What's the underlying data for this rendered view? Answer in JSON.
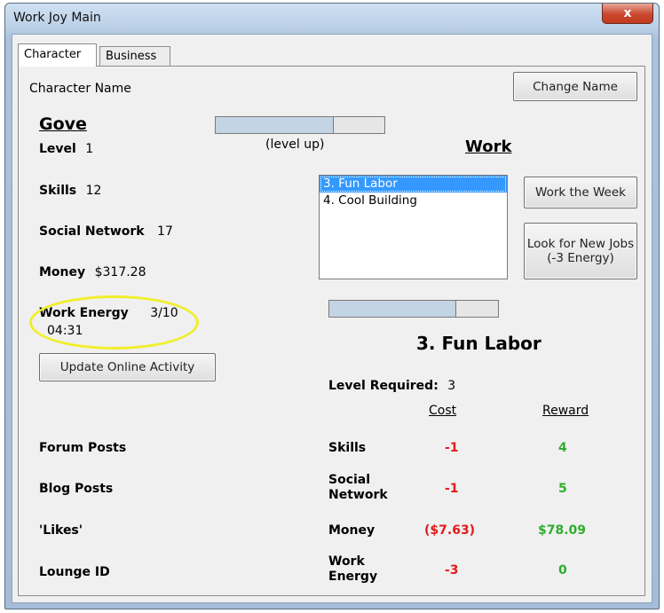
{
  "window": {
    "title": "Work Joy Main",
    "close_glyph": "x"
  },
  "tabs": [
    {
      "label": "Character",
      "active": true
    },
    {
      "label": "Business",
      "active": false
    }
  ],
  "character": {
    "name_label": "Character Name",
    "name": "Gove",
    "change_name_button": "Change Name",
    "level_label": "Level",
    "level_value": "1",
    "level_progress": 0.7,
    "level_up_text": "(level up)",
    "skills_label": "Skills",
    "skills_value": "12",
    "social_label": "Social Network",
    "social_value": "17",
    "money_label": "Money",
    "money_value": "$317.28",
    "energy_label": "Work Energy",
    "energy_value": "3/10",
    "energy_timer": "04:31",
    "update_button": "Update Online Activity",
    "forum_label": "Forum Posts",
    "blog_label": "Blog Posts",
    "likes_label": "'Likes'",
    "lounge_label": "Lounge ID"
  },
  "work": {
    "heading": "Work",
    "jobs": [
      {
        "label": "3. Fun Labor",
        "selected": true
      },
      {
        "label": "4. Cool Building",
        "selected": false
      }
    ],
    "work_week_button": "Work the Week",
    "look_jobs_button_line1": "Look for New Jobs",
    "look_jobs_button_line2": "(-3 Energy)",
    "job_progress": 0.75,
    "selected_job_title": "3. Fun Labor",
    "level_required_label": "Level Required:",
    "level_required_value": "3",
    "cost_header": "Cost",
    "reward_header": "Reward",
    "rows": [
      {
        "label_line1": "Skills",
        "label_line2": "",
        "cost": "-1",
        "reward": "4"
      },
      {
        "label_line1": "Social",
        "label_line2": "Network",
        "cost": "-1",
        "reward": "5"
      },
      {
        "label_line1": "Money",
        "label_line2": "",
        "cost": "($7.63)",
        "reward": "$78.09"
      },
      {
        "label_line1": "Work",
        "label_line2": "Energy",
        "cost": "-3",
        "reward": "0"
      }
    ]
  },
  "colors": {
    "cost": "#e21b1b",
    "reward": "#2eae2e",
    "highlight": "#f1ee2a",
    "selection": "#3399ff"
  }
}
